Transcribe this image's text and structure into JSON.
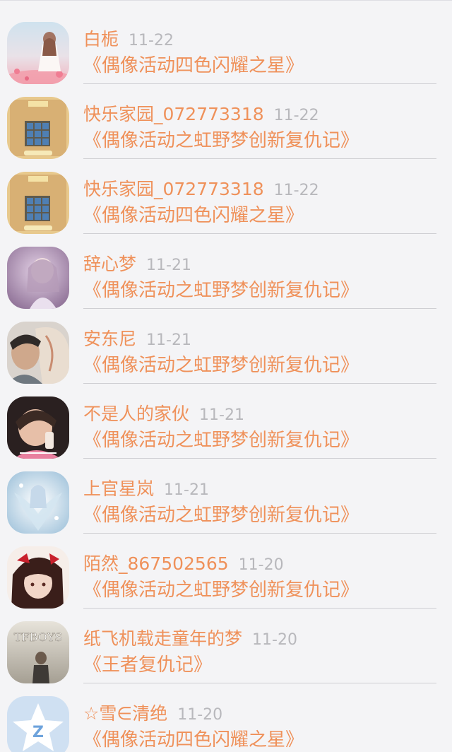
{
  "comments": [
    {
      "name": "白栀",
      "date": "11-22",
      "title": "《偶像活动四色闪耀之星》",
      "avatar": "pink-girl-avatar"
    },
    {
      "name": "快乐家园_072773318",
      "date": "11-22",
      "title": "《偶像活动之虹野梦创新复仇记》",
      "avatar": "game-screen-avatar"
    },
    {
      "name": "快乐家园_072773318",
      "date": "11-22",
      "title": "《偶像活动四色闪耀之星》",
      "avatar": "game-screen-avatar"
    },
    {
      "name": "辞心梦",
      "date": "11-21",
      "title": "《偶像活动之虹野梦创新复仇记》",
      "avatar": "purple-girl-avatar"
    },
    {
      "name": "安东尼",
      "date": "11-21",
      "title": "《偶像活动之虹野梦创新复仇记》",
      "avatar": "boy-avatar"
    },
    {
      "name": "不是人的家伙",
      "date": "11-21",
      "title": "《偶像活动之虹野梦创新复仇记》",
      "avatar": "girl-photo-avatar"
    },
    {
      "name": "上官星岚",
      "date": "11-21",
      "title": "《偶像活动之虹野梦创新复仇记》",
      "avatar": "anime-angel-avatar"
    },
    {
      "name": "陌然_867502565",
      "date": "11-20",
      "title": "《偶像活动之虹野梦创新复仇记》",
      "avatar": "red-hair-anime-avatar"
    },
    {
      "name": "纸飞机载走童年的梦",
      "date": "11-20",
      "title": "《王者复仇记》",
      "avatar": "tfboys-avatar"
    },
    {
      "name": "☆雪∈清绝",
      "date": "11-20",
      "title": "《偶像活动四色闪耀之星》",
      "avatar": "qq-star-avatar"
    }
  ],
  "avatar_texts": {
    "tfboys": "TFBOYS",
    "qq": "Z"
  }
}
